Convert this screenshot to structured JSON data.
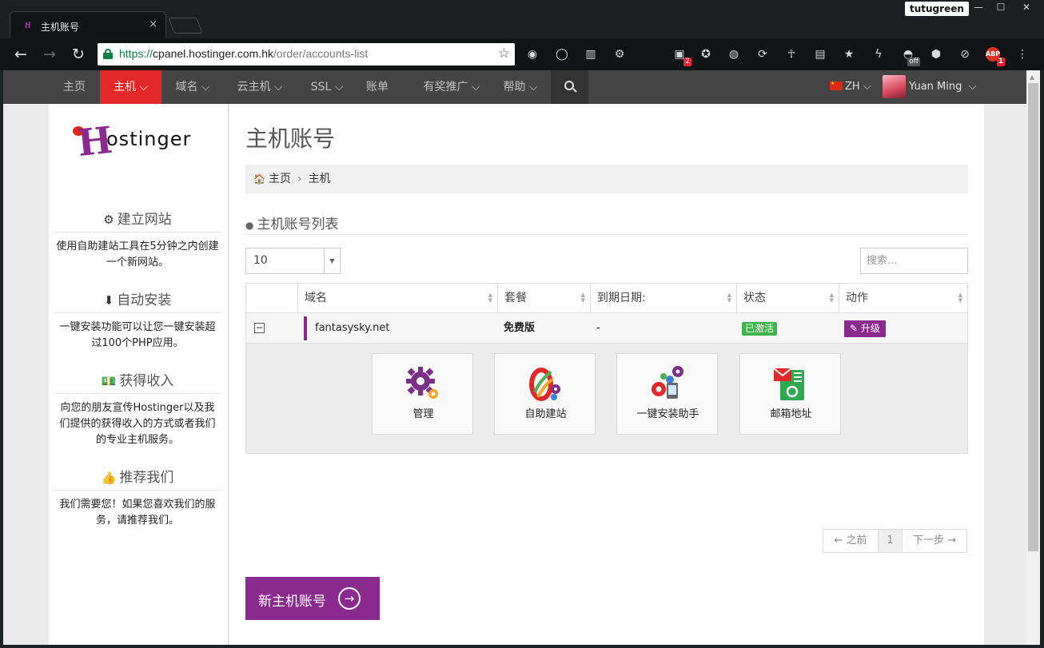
{
  "browser": {
    "tab_title": "主机账号",
    "tab_close": "×",
    "profile": "tutugreen",
    "window_controls": {
      "minimize": "—",
      "maximize": "☐",
      "close": "✕"
    },
    "nav": {
      "back": "←",
      "forward": "→",
      "reload": "↻"
    },
    "url": {
      "scheme": "https://",
      "host": "cpanel.hostinger.com.hk",
      "path": "/order/accounts-list"
    },
    "bookmark_icon": "☆",
    "extensions": [
      {
        "name": "color-picker-icon",
        "glyph": "◉"
      },
      {
        "name": "record-icon",
        "glyph": "◯"
      },
      {
        "name": "stats-icon",
        "glyph": "▥"
      },
      {
        "name": "settings-ext-icon",
        "glyph": "⚙"
      },
      {
        "name": "mail-ext-icon",
        "glyph": "▣",
        "badge": "2"
      },
      {
        "name": "soccer-icon",
        "glyph": "✪"
      },
      {
        "name": "lightbulb-icon",
        "glyph": "◍"
      },
      {
        "name": "sync-icon",
        "glyph": "⟳"
      },
      {
        "name": "ankh-icon",
        "glyph": "☥"
      },
      {
        "name": "notes-icon",
        "glyph": "▤"
      },
      {
        "name": "bookmark-star-icon",
        "glyph": "★"
      },
      {
        "name": "bolt-icon",
        "glyph": "ϟ"
      },
      {
        "name": "proxy-icon",
        "glyph": "◓",
        "badge": "off"
      },
      {
        "name": "hex-icon",
        "glyph": "⬢"
      },
      {
        "name": "block-icon",
        "glyph": "⊘"
      },
      {
        "name": "adblock-icon",
        "glyph": "ABP",
        "badge": "1"
      },
      {
        "name": "menu-icon",
        "glyph": "⋮"
      }
    ]
  },
  "nav": {
    "items": [
      "主页",
      "主机",
      "域名",
      "云主机",
      "SSL",
      "账单",
      "有奖推广",
      "帮助"
    ],
    "chevron": "⌵",
    "lang": "ZH",
    "user": "Yuan Ming"
  },
  "sidebar": {
    "logo_text": "ostinger",
    "logo_h": "H",
    "blocks": [
      {
        "title": "建立网站",
        "icon": "⚙",
        "text": "使用自助建站工具在5分钟之内创建一个新网站。"
      },
      {
        "title": "自动安装",
        "icon": "⬇",
        "text": "一键安装功能可以让您一键安装超过100个PHP应用。"
      },
      {
        "title": "获得收入",
        "icon": "💵",
        "text": "向您的朋友宣传Hostinger以及我们提供的获得收入的方式或者我们的专业主机服务。"
      },
      {
        "title": "推荐我们",
        "icon": "👍",
        "text": "我们需要您！如果您喜欢我们的服务，请推荐我们。"
      }
    ]
  },
  "main": {
    "title": "主机账号",
    "breadcrumb": {
      "home": "主页",
      "current": "主机",
      "sep": "›"
    },
    "section_title": "主机账号列表",
    "page_size": "10",
    "search_placeholder": "搜索...",
    "columns": [
      "域名",
      "套餐",
      "到期日期:",
      "状态",
      "动作"
    ],
    "row": {
      "expander": "−",
      "domain": "fantasysky.net",
      "plan": "免费版",
      "expiry": "-",
      "status": "已激活",
      "action": "✎ 升级"
    },
    "tiles": [
      "管理",
      "自助建站",
      "一键安装助手",
      "邮箱地址"
    ],
    "pager": {
      "prev": "← 之前",
      "page": "1",
      "next": "下一步 →"
    },
    "new_account": "新主机账号",
    "new_account_arrow": "→"
  },
  "colors": {
    "brand": "#8a2a8f",
    "nav_active": "#e2292a",
    "status_active": "#3cb44a"
  }
}
